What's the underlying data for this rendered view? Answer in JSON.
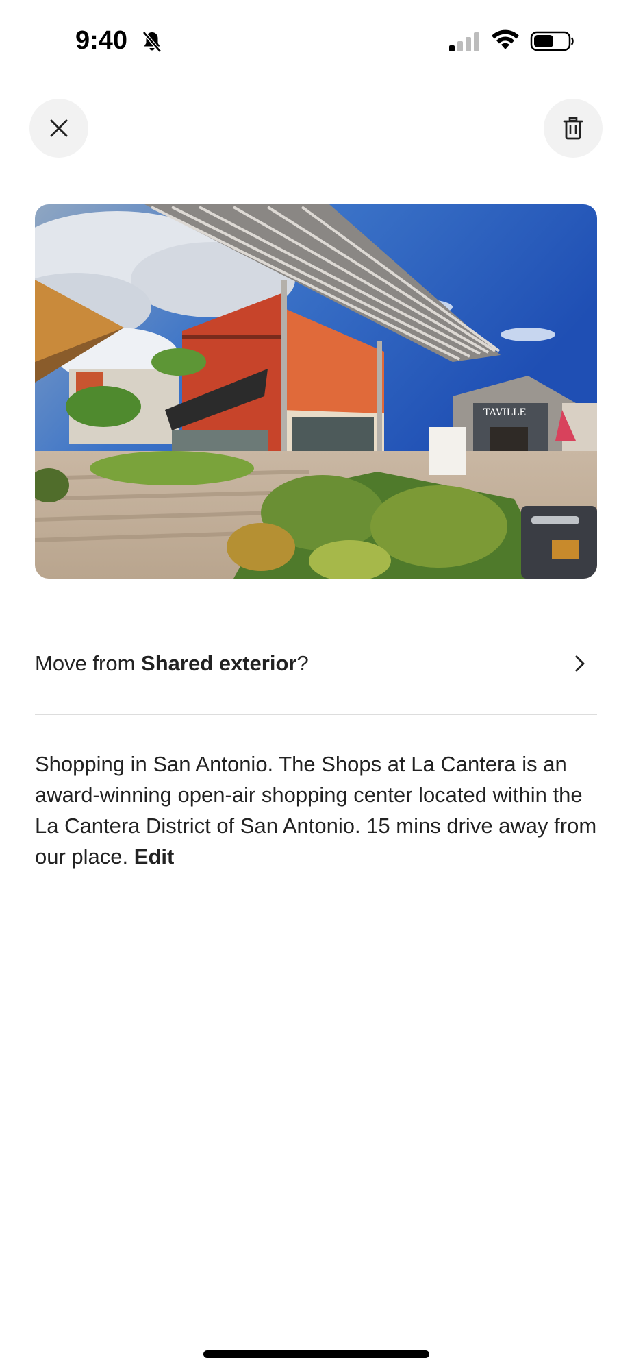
{
  "status_bar": {
    "time": "9:40",
    "icons": [
      "bell-slash-icon",
      "cellular-signal-icon",
      "wifi-icon",
      "battery-icon"
    ]
  },
  "header": {
    "close_icon": "close-icon",
    "delete_icon": "trash-icon"
  },
  "photo": {
    "alt": "Shopping in San Antonio. The Shops at La Cantera",
    "sign_text": "TAVILLE"
  },
  "move_row": {
    "prefix": "Move from ",
    "category": "Shared exterior",
    "suffix": "?"
  },
  "caption": {
    "text": "Shopping in San Antonio. The Shops at La Cantera is an award-winning open-air shopping center located within the La Cantera District of San Antonio. 15 mins drive away from our place. ",
    "edit_label": "Edit"
  },
  "colors": {
    "text": "#222222",
    "button_bg": "#f2f2f2",
    "divider": "#dddddd"
  }
}
